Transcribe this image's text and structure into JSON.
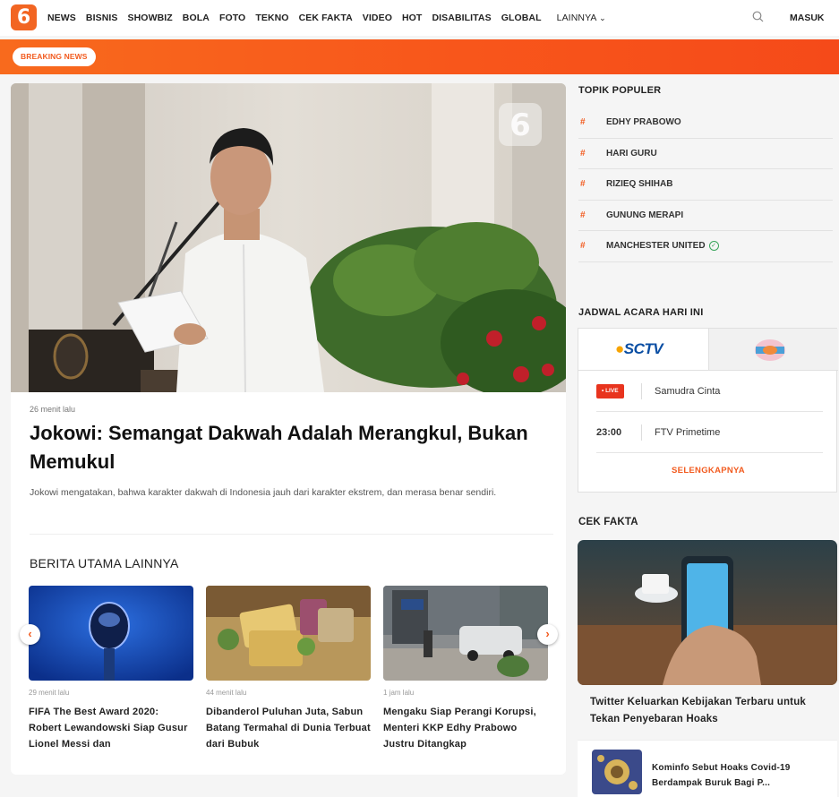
{
  "brand": {
    "logo": "6",
    "accent": "#f25b1f"
  },
  "nav": {
    "items": [
      "NEWS",
      "BISNIS",
      "SHOWBIZ",
      "BOLA",
      "FOTO",
      "TEKNO",
      "CEK FAKTA",
      "VIDEO",
      "HOT",
      "DISABILITAS",
      "GLOBAL"
    ],
    "more_label": "LAINNYA",
    "login_label": "MASUK",
    "search_icon": "search-icon"
  },
  "breaking": {
    "label": "BREAKING NEWS"
  },
  "headline": {
    "time": "26 menit lalu",
    "title": "Jokowi: Semangat Dakwah Adalah Merangkul, Bukan Memukul",
    "summary": "Jokowi mengatakan, bahwa karakter dakwah di Indonesia jauh dari karakter ekstrem, dan merasa benar sendiri."
  },
  "other_news": {
    "title": "BERITA UTAMA LAINNYA",
    "items": [
      {
        "time": "29 menit lalu",
        "title": "FIFA The Best Award 2020: Robert Lewandowski Siap Gusur Lionel Messi dan"
      },
      {
        "time": "44 menit lalu",
        "title": "Dibanderol Puluhan Juta, Sabun Batang Termahal di Dunia Terbuat dari Bubuk"
      },
      {
        "time": "1 jam lalu",
        "title": "Mengaku Siap Perangi Korupsi, Menteri KKP Edhy Prabowo Justru Ditangkap"
      }
    ]
  },
  "popular": {
    "title": "TOPIK POPULER",
    "topics": [
      "EDHY PRABOWO",
      "HARI GURU",
      "RIZIEQ SHIHAB",
      "GUNUNG MERAPI",
      "MANCHESTER UNITED"
    ]
  },
  "schedule": {
    "title": "JADWAL ACARA HARI INI",
    "channel_1": "SCTV",
    "live_label": "• LIVE",
    "now_show": "Samudra Cinta",
    "next_time": "23:00",
    "next_show": "FTV Primetime",
    "more_label": "SELENGKAPNYA"
  },
  "fact_check": {
    "title": "CEK FAKTA",
    "main_title": "Twitter Keluarkan Kebijakan Terbaru untuk Tekan Penyebaran Hoaks",
    "item_title": "Kominfo Sebut Hoaks Covid-19 Berdampak Buruk Bagi P..."
  }
}
